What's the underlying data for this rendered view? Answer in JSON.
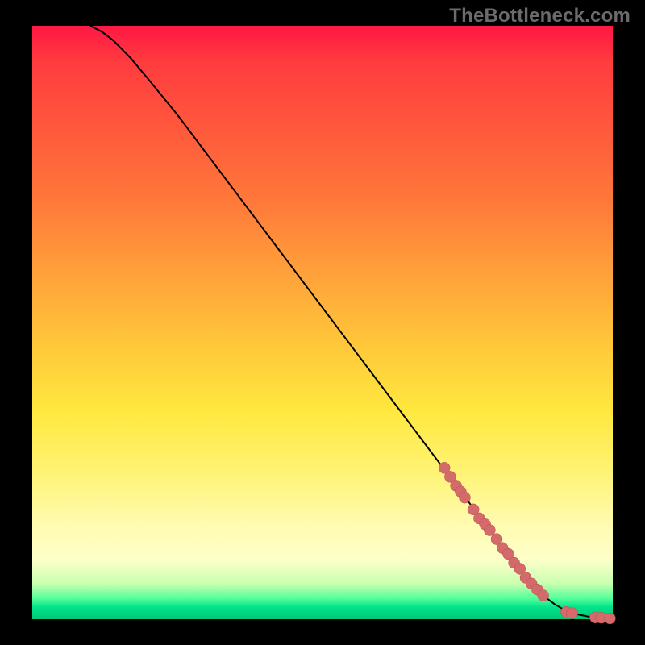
{
  "watermark": "TheBottleneck.com",
  "chart_data": {
    "type": "line",
    "title": "",
    "xlabel": "",
    "ylabel": "",
    "xlim": [
      0,
      100
    ],
    "ylim": [
      0,
      100
    ],
    "grid": false,
    "legend": false,
    "curve": {
      "x": [
        10,
        12,
        14,
        17,
        20,
        25,
        30,
        35,
        40,
        45,
        50,
        55,
        60,
        65,
        70,
        73,
        75,
        78,
        80,
        82,
        84,
        86,
        87,
        88,
        90,
        92,
        94,
        96,
        98,
        100
      ],
      "y": [
        100,
        99,
        97.5,
        94.5,
        91,
        85,
        78.5,
        72,
        65.5,
        59,
        52.5,
        46,
        39.5,
        33,
        26.5,
        22.5,
        20,
        16,
        13.5,
        11,
        8.5,
        6,
        5,
        4,
        2.5,
        1.4,
        0.8,
        0.4,
        0.2,
        0.1
      ]
    },
    "highlight_points": {
      "x": [
        71,
        72,
        73,
        73.8,
        74.5,
        76,
        77,
        78,
        78.8,
        80,
        81,
        82,
        83,
        84,
        85,
        86,
        87,
        88,
        92,
        93,
        97,
        98,
        99.5
      ],
      "y": [
        25.5,
        24,
        22.5,
        21.5,
        20.5,
        18.5,
        17,
        16,
        15,
        13.5,
        12,
        11,
        9.5,
        8.5,
        7,
        6,
        5,
        4,
        1.2,
        1.0,
        0.3,
        0.25,
        0.15
      ]
    }
  }
}
